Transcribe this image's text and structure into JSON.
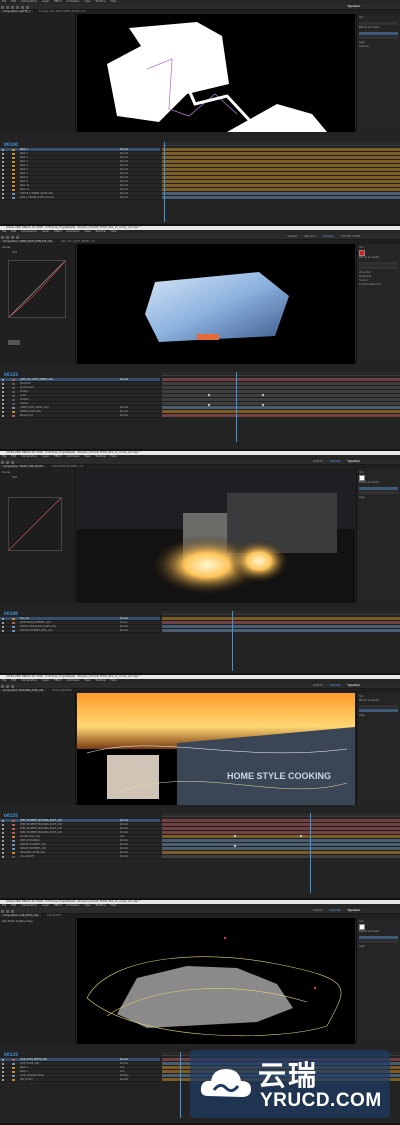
{
  "app": {
    "window_title": "Adobe After Effects CC 2018 - D:\\Frame_Forge\\Skybll\\...\\Project_CCA\\AE_TOUR_S01_11_comp_v17.aep *",
    "menus": [
      "File",
      "Edit",
      "Composition",
      "Layer",
      "Effect",
      "Animation",
      "View",
      "Window",
      "Help"
    ],
    "workspaces": [
      "Default",
      "Standard",
      "Small Screen",
      "Libraries",
      "CURVES_COMP",
      "Essential Graphics"
    ],
    "active_workspace": "Libraries",
    "brand_tag": "Typeblur"
  },
  "shots": [
    {
      "id": "shot1",
      "timecode": "00100",
      "comp_tabs": [
        "Composition: MATTE_T",
        "Footage: JARI_RAW_INSERT_PLATE_v01"
      ],
      "viewer_zoom": "50%",
      "render_quality": "Half",
      "layers": [
        {
          "name": "Mask 1",
          "mode": "Normal",
          "color": "#c98b2a"
        },
        {
          "name": "Mask 2",
          "mode": "Normal",
          "color": "#c98b2a"
        },
        {
          "name": "Mask 3",
          "mode": "Normal",
          "color": "#c98b2a"
        },
        {
          "name": "Mask 4",
          "mode": "Normal",
          "color": "#c98b2a"
        },
        {
          "name": "Mask 5",
          "mode": "Normal",
          "color": "#c98b2a"
        },
        {
          "name": "Mask 6",
          "mode": "Normal",
          "color": "#c98b2a"
        },
        {
          "name": "Mask 7",
          "mode": "Normal",
          "color": "#c98b2a"
        },
        {
          "name": "Mask 8",
          "mode": "Normal",
          "color": "#c98b2a"
        },
        {
          "name": "Mask 9",
          "mode": "Normal",
          "color": "#c98b2a"
        },
        {
          "name": "Mask 10",
          "mode": "Normal",
          "color": "#c98b2a"
        },
        {
          "name": "Mask 11",
          "mode": "Normal",
          "color": "#c98b2a"
        },
        {
          "name": "[MATTE_T_INSERT_PLATE_v01]",
          "mode": "Normal",
          "color": "#6b8fb3"
        },
        {
          "name": "[JARI_T_FRAME_PLATE_v01.exr]",
          "mode": "Normal",
          "color": "#6b8fb3"
        }
      ],
      "right_panel": {
        "tab": "Info",
        "items": [
          "Info",
          "Audio",
          "Preview",
          "Effects & Presets",
          "Align",
          "Libraries"
        ]
      }
    },
    {
      "id": "shot2",
      "timecode": "00123",
      "comp_tabs": [
        "Composition: OREN_ROOF_REPLACE_v02",
        "JARI_CAR_LIGHT_INSERT_v01"
      ],
      "effect_controls_title": "Curves",
      "channel": "RGB",
      "viewer_zoom": "50%",
      "layers": [
        {
          "name": "[JARI_CAR_LIGHT_INSERT_v01]",
          "mode": "Normal",
          "color": "#b35b5b"
        },
        {
          "name": "Transform",
          "mode": "",
          "color": "#555"
        },
        {
          "name": "Anchor Point",
          "mode": "",
          "color": "#555"
        },
        {
          "name": "Position",
          "mode": "",
          "color": "#555"
        },
        {
          "name": "Scale",
          "mode": "",
          "color": "#555"
        },
        {
          "name": "Rotation",
          "mode": "",
          "color": "#555"
        },
        {
          "name": "Opacity",
          "mode": "",
          "color": "#555"
        },
        {
          "name": "[OREN_ROOF_MATTE_v02]",
          "mode": "Normal",
          "color": "#6b8fb3"
        },
        {
          "name": "[OREN_PLATE_v02]",
          "mode": "Normal",
          "color": "#c98b2a"
        },
        {
          "name": "Background",
          "mode": "Normal",
          "color": "#b35b5b"
        }
      ],
      "right_panel": {
        "tab": "Info",
        "items": [
          "Info",
          "Audio",
          "Preview",
          "Effects & Presets",
          "Align",
          "Libraries",
          "Character",
          "Paragraph",
          "Tracker",
          "Content-Aware Fill"
        ]
      }
    },
    {
      "id": "shot3",
      "timecode": "00108",
      "comp_tabs": [
        "Composition: TRUCK_FIRE_BLAST",
        "EXPLOSION_ELEMENT_v03"
      ],
      "effect_controls_title": "Curves",
      "channel": "RGB",
      "viewer_zoom": "50%",
      "layers": [
        {
          "name": "Fire_v01",
          "mode": "Normal",
          "color": "#c98b2a"
        },
        {
          "name": "[EXPLOSION_ELEMENT_v03]",
          "mode": "Screen",
          "color": "#b35b5b"
        },
        {
          "name": "[TRUCK_FIRE_BLAST_PLATE_v01]",
          "mode": "Normal",
          "color": "#6b8fb3"
        },
        {
          "name": "[SMOKE_ELEMENT_PASS_v01]",
          "mode": "Normal",
          "color": "#6b8fb3"
        }
      ],
      "right_panel": {
        "tab": "Info",
        "items": [
          "Info",
          "Audio",
          "Preview",
          "Effects & Presets",
          "Align"
        ]
      }
    },
    {
      "id": "shot4",
      "timecode": "00155",
      "comp_tabs": [
        "Composition: BUILDING_FIRE_v04",
        "ROTO_BUILDING"
      ],
      "sign_text": "HOME STYLE COOKING",
      "viewer_zoom": "50%",
      "layers": [
        {
          "name": "[FIRE_ELEMENT_BUILDING_ROOF_v01]",
          "mode": "Normal",
          "color": "#b35b5b"
        },
        {
          "name": "[FIRE_ELEMENT_BUILDING_ROOF_v02]",
          "mode": "Normal",
          "color": "#b35b5b"
        },
        {
          "name": "[FIRE_ELEMENT_BUILDING_ROOF_v03]",
          "mode": "Normal",
          "color": "#b35b5b"
        },
        {
          "name": "[FIRE_ELEMENT_BUILDING_ROOF_v04]",
          "mode": "Normal",
          "color": "#b35b5b"
        },
        {
          "name": "[GLOW_PASS_v01]",
          "mode": "Add",
          "color": "#c98b2a"
        },
        {
          "name": "[ROTO_BUILDING]",
          "mode": "Normal",
          "color": "#6b8fb3"
        },
        {
          "name": "[SMOKE_ELEMENT_v02]",
          "mode": "Normal",
          "color": "#6b8fb3"
        },
        {
          "name": "[SMOKE_ELEMENT_v03]",
          "mode": "Normal",
          "color": "#6b8fb3"
        },
        {
          "name": "[BUILDING_PLATE_v01]",
          "mode": "Normal",
          "color": "#c98b2a"
        },
        {
          "name": "[CC_ADJUST]",
          "mode": "Normal",
          "color": "#555"
        }
      ],
      "right_panel": {
        "tab": "Info",
        "items": [
          "Info",
          "Audio",
          "Preview",
          "Effects & Presets",
          "Align"
        ]
      }
    },
    {
      "id": "shot5",
      "timecode": "00125",
      "comp_tabs": [
        "Composition: CAR_ROTO_v05",
        "CAR_MATTE"
      ],
      "effect_controls_title": "Roto Brush & Refine Edge",
      "viewer_zoom": "50%",
      "layers": [
        {
          "name": "[CAR_ROTO_MATTE_v05]",
          "mode": "Normal",
          "color": "#b35b5b"
        },
        {
          "name": "[CAR_PLATE_v05]",
          "mode": "Normal",
          "color": "#6b8fb3"
        },
        {
          "name": "Mask 1",
          "mode": "Add",
          "color": "#c98b2a"
        },
        {
          "name": "Mask 2",
          "mode": "Add",
          "color": "#c98b2a"
        },
        {
          "name": "[CAR_SHADOW_PASS]",
          "mode": "Multiply",
          "color": "#6b8fb3"
        },
        {
          "name": "[BG_PLATE]",
          "mode": "Normal",
          "color": "#c98b2a"
        }
      ],
      "right_panel": {
        "tab": "Info",
        "items": [
          "Info",
          "Audio",
          "Preview",
          "Effects & Presets",
          "Align"
        ]
      }
    }
  ],
  "watermark": {
    "cn": "云瑞",
    "en": "YRUCD.COM",
    "colors": {
      "bg": "#1e3c64",
      "text": "#ffffff"
    }
  }
}
